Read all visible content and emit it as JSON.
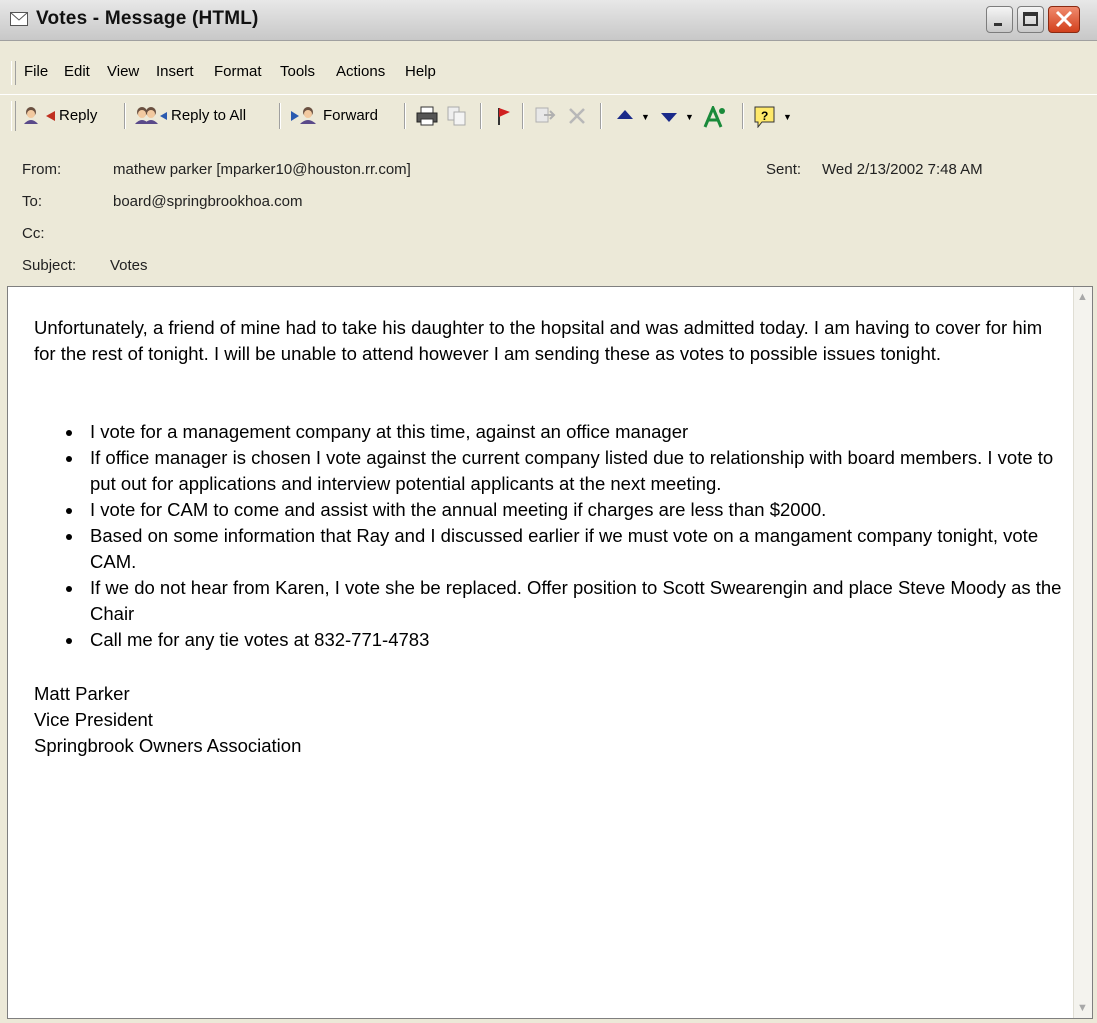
{
  "window": {
    "title": "Votes - Message (HTML)"
  },
  "menu": [
    {
      "label": "File"
    },
    {
      "label": "Edit"
    },
    {
      "label": "View"
    },
    {
      "label": "Insert"
    },
    {
      "label": "Format"
    },
    {
      "label": "Tools"
    },
    {
      "label": "Actions"
    },
    {
      "label": "Help"
    }
  ],
  "toolbar": {
    "reply_label": "Reply",
    "reply_all_label": "Reply to All",
    "forward_label": "Forward",
    "icons": [
      "print-icon",
      "copy-icon",
      "flag-icon",
      "move-icon",
      "delete-icon",
      "previous-item-icon",
      "next-item-icon",
      "address-book-icon",
      "help-icon"
    ]
  },
  "header": {
    "from_label": "From:",
    "from_value": "mathew parker [mparker10@houston.rr.com]",
    "sent_label": "Sent:",
    "sent_value": "Wed 2/13/2002 7:48 AM",
    "to_label": "To:",
    "to_value": "board@springbrookhoa.com",
    "cc_label": "Cc:",
    "cc_value": "",
    "subject_label": "Subject:",
    "subject_value": "Votes"
  },
  "message": {
    "intro": "Unfortunately, a friend of mine had to take his daughter to the hopsital and was admitted today.  I am having to cover for him for the rest of tonight.  I will be unable to attend however I am sending these as votes to possible issues tonight.",
    "bullets": [
      "I vote for a management company at this time, against an office manager",
      "If office manager is chosen I vote against the current company listed due to relationship with board members.  I vote to put out for applications and interview potential applicants at the next meeting.",
      "I vote for CAM to come and assist with the annual meeting if charges are less than $2000.",
      "Based on some information that Ray and I discussed earlier if we must vote on a mangament company tonight, vote CAM.",
      "If we do not hear from Karen, I vote she be replaced.  Offer position to Scott Swearengin and place Steve Moody as the Chair",
      "Call me for any tie votes at 832-771-4783"
    ],
    "signature": [
      "Matt Parker",
      "Vice President",
      "Springbrook Owners Association"
    ]
  },
  "colors": {
    "chrome": "#ece9d8",
    "close_button": "#d2401c",
    "body_bg": "#ffffff"
  }
}
